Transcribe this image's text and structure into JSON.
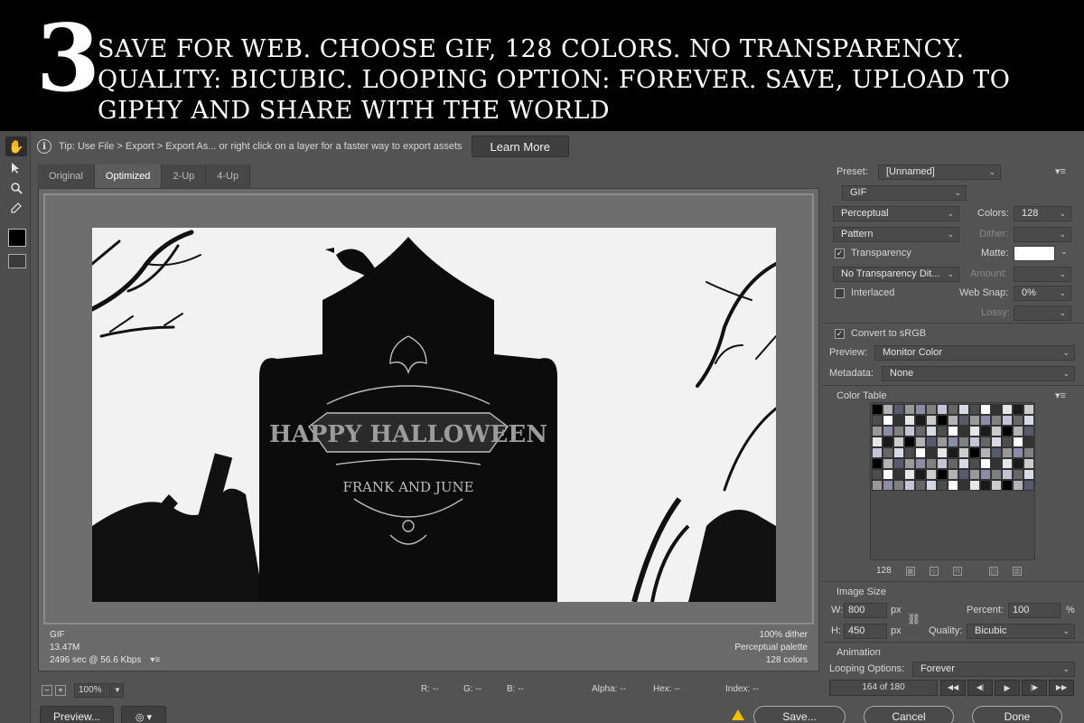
{
  "banner": {
    "step_number": "3",
    "instruction": "SAVE FOR WEB. CHOOSE GIF, 128 COLORS. NO TRANSPARENCY. QUALITY: BICUBIC. LOOPING OPTION: FOREVER. SAVE, UPLOAD TO GIPHY AND SHARE WITH THE WORLD"
  },
  "tools": [
    {
      "name": "hand-tool",
      "icon": "hand-icon"
    },
    {
      "name": "slice-select-tool",
      "icon": "slice-select-icon"
    },
    {
      "name": "zoom-tool",
      "icon": "magnifier-icon"
    },
    {
      "name": "eyedropper-tool",
      "icon": "eyedropper-icon"
    }
  ],
  "tip": {
    "text": "Tip: Use File > Export > Export As...  or right click on a layer for a faster way to export assets",
    "learn_more": "Learn More"
  },
  "tabs": [
    "Original",
    "Optimized",
    "2-Up",
    "4-Up"
  ],
  "active_tab": "Optimized",
  "artwork": {
    "headline": "HAPPY HALLOWEEN",
    "subline": "FRANK AND JUNE"
  },
  "image_info": {
    "format": "GIF",
    "size": "13.47M",
    "download_time": "2496 sec @ 56.6 Kbps",
    "dither": "100% dither",
    "palette": "Perceptual palette",
    "colors": "128 colors"
  },
  "status": {
    "zoom": "100%",
    "r": "R: --",
    "g": "G: --",
    "b": "B: --",
    "alpha": "Alpha: --",
    "hex": "Hex: --",
    "index": "Index: --"
  },
  "buttons": {
    "preview": "Preview...",
    "save": "Save...",
    "cancel": "Cancel",
    "done": "Done"
  },
  "panel": {
    "preset_label": "Preset:",
    "preset_value": "[Unnamed]",
    "format_value": "GIF",
    "reduction": "Perceptual",
    "colors_label": "Colors:",
    "colors_value": "128",
    "dither_algo": "Pattern",
    "dither_label": "Dither:",
    "transparency_label": "Transparency",
    "matte_label": "Matte:",
    "transparency_dither": "No Transparency Dit...",
    "amount_label": "Amount:",
    "interlaced_label": "Interlaced",
    "websnap_label": "Web Snap:",
    "websnap_value": "0%",
    "lossy_label": "Lossy:",
    "srgb_label": "Convert to sRGB",
    "preview_label": "Preview:",
    "preview_value": "Monitor Color",
    "metadata_label": "Metadata:",
    "metadata_value": "None",
    "color_table_title": "Color Table",
    "color_count": "128",
    "image_size_title": "Image Size",
    "w_label": "W:",
    "w_value": "800",
    "h_label": "H:",
    "h_value": "450",
    "px": "px",
    "percent_label": "Percent:",
    "percent_value": "100",
    "percent_unit": "%",
    "quality_label": "Quality:",
    "quality_value": "Bicubic",
    "animation_title": "Animation",
    "looping_label": "Looping Options:",
    "looping_value": "Forever",
    "frame_counter": "164 of 180"
  },
  "colors": {
    "banner_bg": "#000000",
    "panel_bg": "#535353",
    "canvas_bg": "#6a6a6a",
    "warning": "#f2c200"
  }
}
